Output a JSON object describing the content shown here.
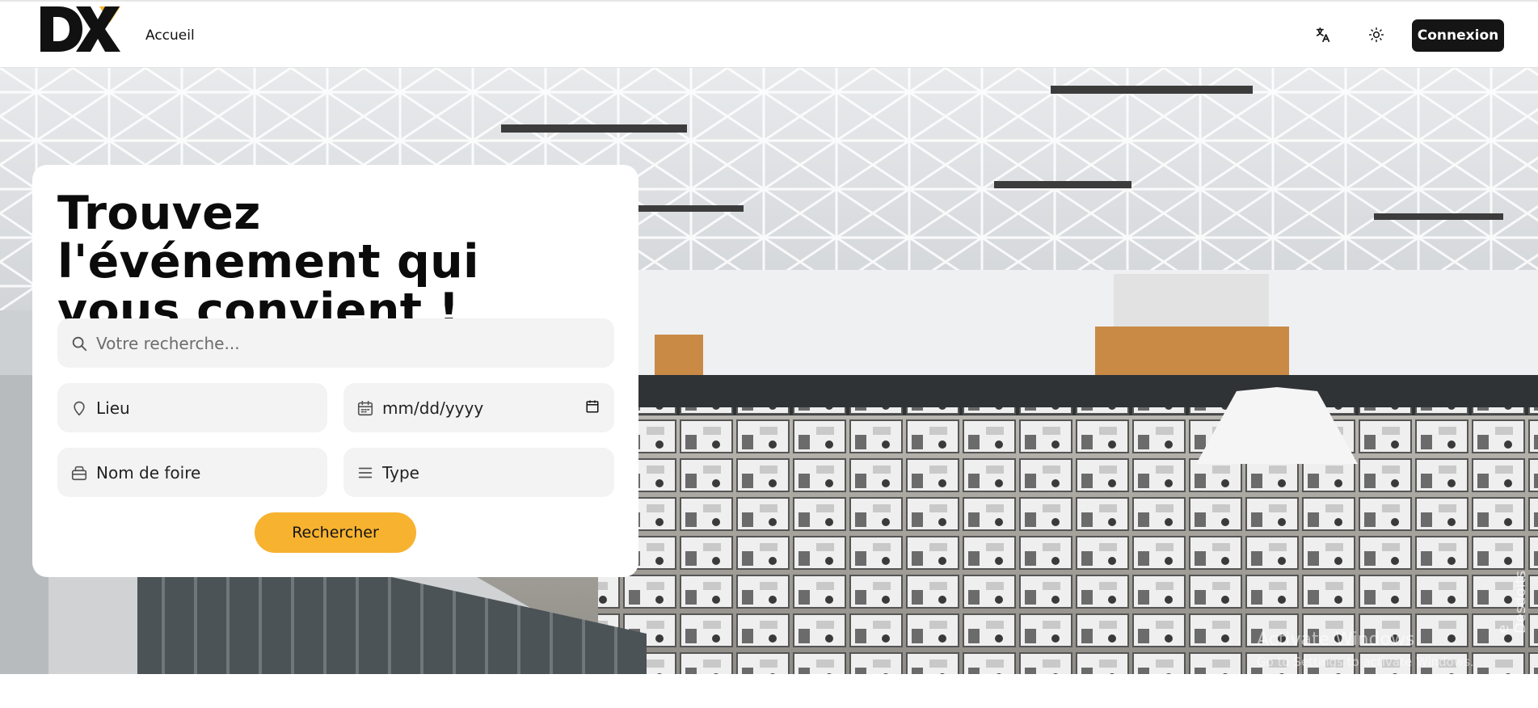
{
  "header": {
    "logo_text": "DX",
    "nav_home": "Accueil",
    "translate_icon": "translate-icon",
    "theme_icon": "sun-icon",
    "login_label": "Connexion"
  },
  "hero": {
    "image_description": "",
    "watermark_line1": "Activate Windows",
    "watermark_line2": "Go to Settings to activate Windows.",
    "credit": "e Desdoits"
  },
  "search": {
    "title": "Trouvez l'événement qui vous convient !",
    "query_placeholder": "Votre recherche...",
    "location_placeholder": "Lieu",
    "date_placeholder": "mm/dd/yyyy",
    "fair_placeholder": "Nom de foire",
    "type_placeholder": "Type",
    "submit_label": "Rechercher"
  },
  "colors": {
    "accent": "#f7b22f",
    "dark": "#151515",
    "field_bg": "#f3f3f3"
  }
}
